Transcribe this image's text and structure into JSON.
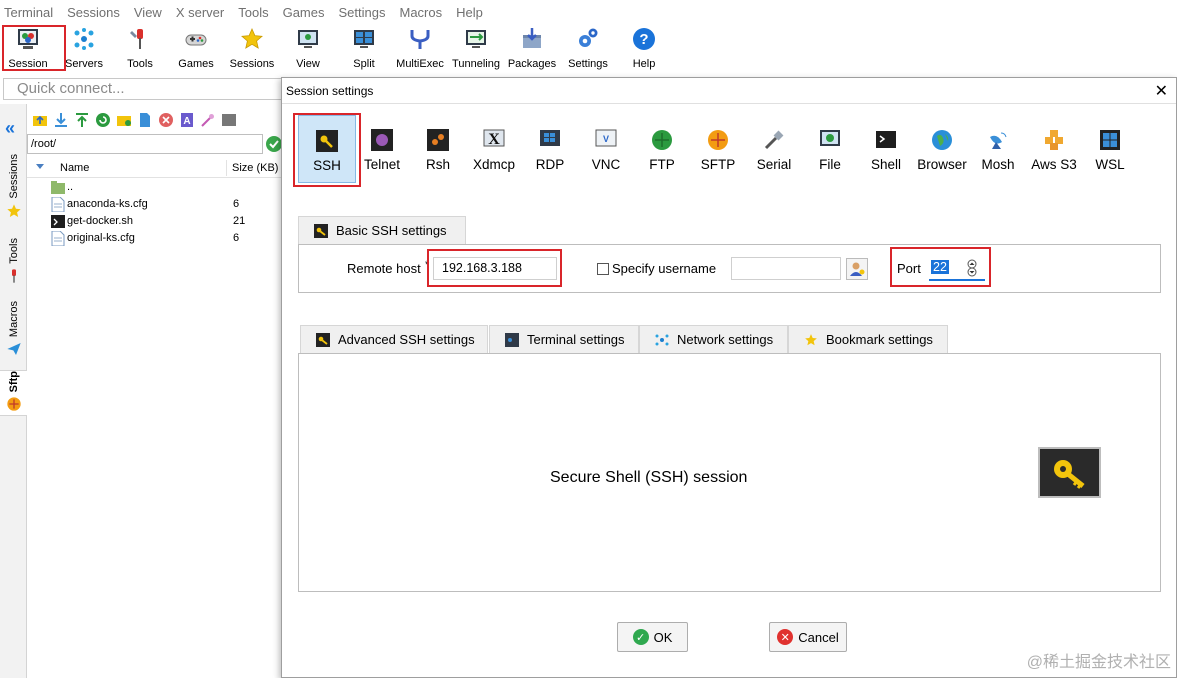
{
  "menu": [
    "Terminal",
    "Sessions",
    "View",
    "X server",
    "Tools",
    "Games",
    "Settings",
    "Macros",
    "Help"
  ],
  "toolbar": {
    "items": [
      {
        "label": "Session",
        "icon": "session-icon"
      },
      {
        "label": "Servers",
        "icon": "servers-icon"
      },
      {
        "label": "Tools",
        "icon": "tools-icon"
      },
      {
        "label": "Games",
        "icon": "games-icon"
      },
      {
        "label": "Sessions",
        "icon": "star-icon"
      },
      {
        "label": "View",
        "icon": "view-icon"
      },
      {
        "label": "Split",
        "icon": "split-icon"
      },
      {
        "label": "MultiExec",
        "icon": "multiexec-icon"
      },
      {
        "label": "Tunneling",
        "icon": "tunneling-icon"
      },
      {
        "label": "Packages",
        "icon": "packages-icon"
      },
      {
        "label": "Settings",
        "icon": "settings-icon"
      },
      {
        "label": "Help",
        "icon": "help-icon"
      }
    ]
  },
  "quick_connect": {
    "placeholder": "Quick connect..."
  },
  "side_tabs": [
    "Sessions",
    "Tools",
    "Macros",
    "Sftp"
  ],
  "sftp": {
    "path": "/root/",
    "columns": {
      "name": "Name",
      "size": "Size (KB)"
    },
    "files": [
      {
        "name": "..",
        "size": "",
        "icon": "folder-up-icon"
      },
      {
        "name": "anaconda-ks.cfg",
        "size": "6",
        "icon": "text-file-icon"
      },
      {
        "name": "get-docker.sh",
        "size": "21",
        "icon": "script-file-icon"
      },
      {
        "name": "original-ks.cfg",
        "size": "6",
        "icon": "text-file-icon"
      }
    ]
  },
  "dialog": {
    "title": "Session settings",
    "session_types": [
      "SSH",
      "Telnet",
      "Rsh",
      "Xdmcp",
      "RDP",
      "VNC",
      "FTP",
      "SFTP",
      "Serial",
      "File",
      "Shell",
      "Browser",
      "Mosh",
      "Aws S3",
      "WSL"
    ],
    "selected_type": "SSH",
    "basic_tab": "Basic SSH settings",
    "remote_host_label": "Remote host",
    "remote_host_required": "*",
    "remote_host_value": "192.168.3.188",
    "specify_username_label": "Specify username",
    "username_value": "",
    "port_label": "Port",
    "port_value": "22",
    "lower_tabs": [
      "Advanced SSH settings",
      "Terminal settings",
      "Network settings",
      "Bookmark settings"
    ],
    "description": "Secure Shell (SSH) session",
    "ok_label": "OK",
    "cancel_label": "Cancel"
  },
  "colors": {
    "highlight_red": "#d9252a",
    "selected_blue": "#cfe6f8",
    "ok_green": "#2fa84f",
    "cancel_red": "#e0322f"
  },
  "watermark": "@稀土掘金技术社区"
}
